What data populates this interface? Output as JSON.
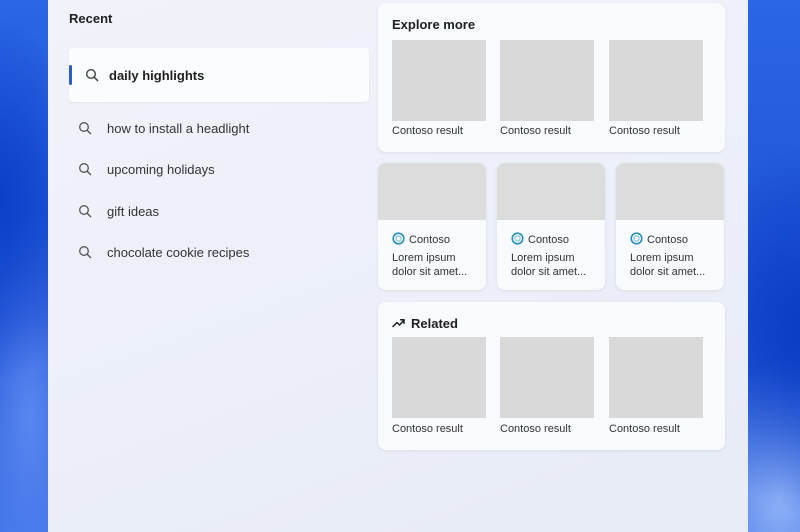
{
  "recent": {
    "title": "Recent",
    "active_query": "daily highlights",
    "items": [
      {
        "label": "how to install a headlight"
      },
      {
        "label": "upcoming holidays"
      },
      {
        "label": "gift ideas"
      },
      {
        "label": "chocolate cookie recipes"
      }
    ]
  },
  "explore": {
    "title": "Explore more",
    "results": [
      {
        "caption": "Contoso result"
      },
      {
        "caption": "Contoso result"
      },
      {
        "caption": "Contoso result"
      }
    ]
  },
  "news": [
    {
      "source": "Contoso",
      "snippet": "Lorem ipsum dolor sit amet..."
    },
    {
      "source": "Contoso",
      "snippet": "Lorem ipsum dolor sit amet..."
    },
    {
      "source": "Contoso",
      "snippet": "Lorem ipsum dolor sit amet..."
    }
  ],
  "related": {
    "title": "Related",
    "icon": "trending-icon",
    "results": [
      {
        "caption": "Contoso result"
      },
      {
        "caption": "Contoso result"
      },
      {
        "caption": "Contoso result"
      }
    ]
  },
  "colors": {
    "accent_bar": "#2f5fbd",
    "thumbnail": "#d9d9d9",
    "source_logo": "#2a8fbf"
  }
}
